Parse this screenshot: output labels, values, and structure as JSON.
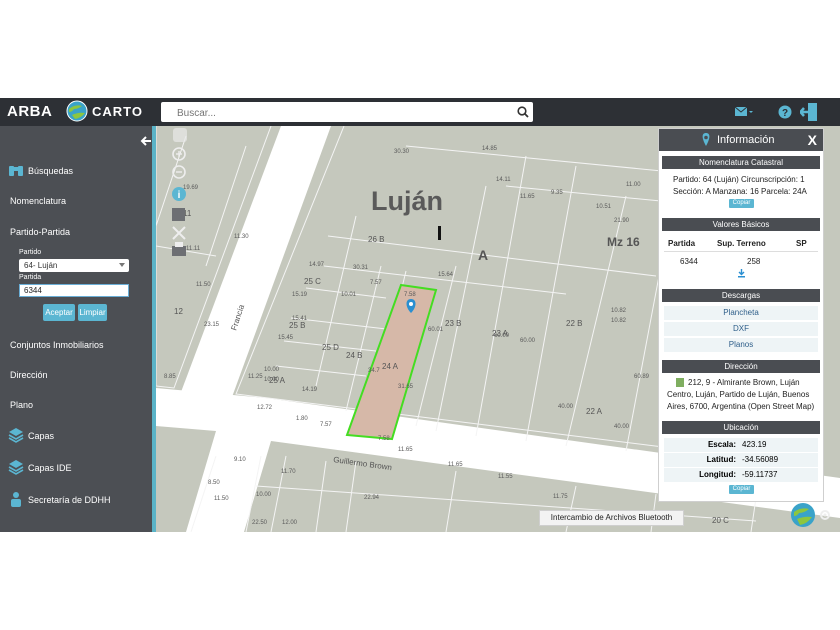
{
  "header": {
    "brand": "ARBA",
    "app_name": "CARTO",
    "search_placeholder": "Buscar..."
  },
  "sidebar": {
    "busquedas": "Búsquedas",
    "nomenclatura": "Nomenclatura",
    "partido_partida": "Partido-Partida",
    "partido_label": "Partido",
    "partido_value": "64- Luján",
    "partida_label": "Partida",
    "partida_value": "6344",
    "aceptar": "Aceptar",
    "limpiar": "Limpiar",
    "conjuntos": "Conjuntos Inmobiliarios",
    "direccion": "Dirección",
    "plano": "Plano",
    "capas": "Capas",
    "capas_ide": "Capas IDE",
    "secretaria": "Secretaría de DDHH"
  },
  "map": {
    "city_label": "Luján",
    "block_letter": "A",
    "manzana": "Mz 16",
    "street_francia": "Francia",
    "street_guillermo": "Guillermo Brown",
    "parcels": [
      "26 B",
      "25 C",
      "25 B",
      "25 D",
      "24 B",
      "24 A",
      "25 A",
      "23 B",
      "23 A",
      "22 B",
      "22 A",
      "12",
      "11",
      "20 C"
    ],
    "measures": [
      "7.58",
      "15.64",
      "60.01",
      "31.65",
      "34.7",
      "7.58",
      "11.65",
      "11.65",
      "11.55",
      "30.31",
      "7.57",
      "10.01",
      "14.97",
      "15.19",
      "15.41",
      "15.45",
      "14.19",
      "12.72",
      "1.80",
      "7.57",
      "30.30",
      "14.85",
      "14.11",
      "9.35",
      "11.65",
      "10.51",
      "21.90",
      "11.00",
      "60.00",
      "60.00",
      "10.82",
      "10.82",
      "60.89",
      "40.00",
      "40.00",
      "11.75",
      "9.10",
      "11.70",
      "11.50",
      "22.94",
      "8.50",
      "10.00",
      "22.50",
      "12.00",
      "11.50",
      "10.00",
      "10.00",
      "11.25",
      "8.85",
      "19.69",
      "11.11",
      "23.15",
      "11.30"
    ]
  },
  "info": {
    "title": "Información",
    "close": "X",
    "nomenclatura": {
      "heading": "Nomenclatura Catastral",
      "line1": "Partido: 64 (Luján) Circunscripción: 1",
      "line2": "Sección: A Manzana: 16 Parcela: 24A",
      "copy": "Copiar"
    },
    "valores": {
      "heading": "Valores Básicos",
      "col_partida": "Partida",
      "col_sup": "Sup. Terreno",
      "col_sp": "SP",
      "partida": "6344",
      "sup": "258"
    },
    "descargas": {
      "heading": "Descargas",
      "items": [
        "Plancheta",
        "DXF",
        "Planos"
      ]
    },
    "direccion": {
      "heading": "Dirección",
      "line1": "212, 9 - Almirante Brown, Luján",
      "line2": "Centro, Luján, Partido de Luján, Buenos",
      "line3": "Aires, 6700, Argentina (Open Street Map)"
    },
    "ubicacion": {
      "heading": "Ubicación",
      "escala_label": "Escala:",
      "escala": "423.19",
      "latitud_label": "Latitud:",
      "latitud": "-34.56089",
      "longitud_label": "Longitud:",
      "longitud": "-59.11737",
      "copy": "Copiar"
    }
  },
  "tooltip": "Intercambio de Archivos Bluetooth",
  "colors": {
    "topbar": "#2d3035",
    "sidebar": "#4c4f54",
    "accent": "#5bb6d2",
    "map_bg": "#c5c8bd",
    "selected_parcel": "#44cc22"
  }
}
